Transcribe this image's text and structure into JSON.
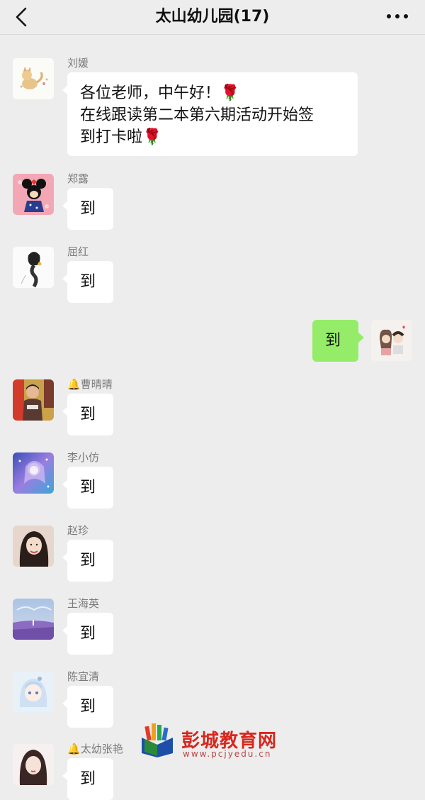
{
  "header": {
    "title": "太山幼儿园(17)"
  },
  "messages": [
    {
      "sender": "刘媛",
      "badge": "",
      "text": "各位老师，中午好！🌹\n在线跟读第二本第六期活动开始签\n到打卡啦🌹",
      "side": "left",
      "avatar": "cat-avatar"
    },
    {
      "sender": "郑露",
      "badge": "",
      "text": "到",
      "side": "left",
      "avatar": "minnie-avatar"
    },
    {
      "sender": "屈红",
      "badge": "",
      "text": "到",
      "side": "left",
      "avatar": "braid-girl-avatar"
    },
    {
      "sender": "",
      "badge": "",
      "text": "到",
      "side": "right",
      "avatar": "couple-avatar"
    },
    {
      "sender": "曹晴晴",
      "badge": "🔔",
      "text": "到",
      "side": "left",
      "avatar": "child-avatar"
    },
    {
      "sender": "李小仿",
      "badge": "",
      "text": "到",
      "side": "left",
      "avatar": "fantasy-avatar"
    },
    {
      "sender": "赵珍",
      "badge": "",
      "text": "到",
      "side": "left",
      "avatar": "woman-avatar"
    },
    {
      "sender": "王海英",
      "badge": "",
      "text": "到",
      "side": "left",
      "avatar": "lavender-field-avatar"
    },
    {
      "sender": "陈宜清",
      "badge": "",
      "text": "到",
      "side": "left",
      "avatar": "anime-girl-avatar"
    },
    {
      "sender": "太幼张艳",
      "badge": "🔔",
      "text": "到",
      "side": "left",
      "avatar": "cartoon-girl-avatar"
    }
  ],
  "watermark": {
    "title": "彭城教育网",
    "url": "www.pcjyedu.cn"
  },
  "colors": {
    "background": "#ededed",
    "bubble_self": "#95ec69",
    "bubble_other": "#ffffff",
    "sender_name": "#7a7a7a"
  }
}
